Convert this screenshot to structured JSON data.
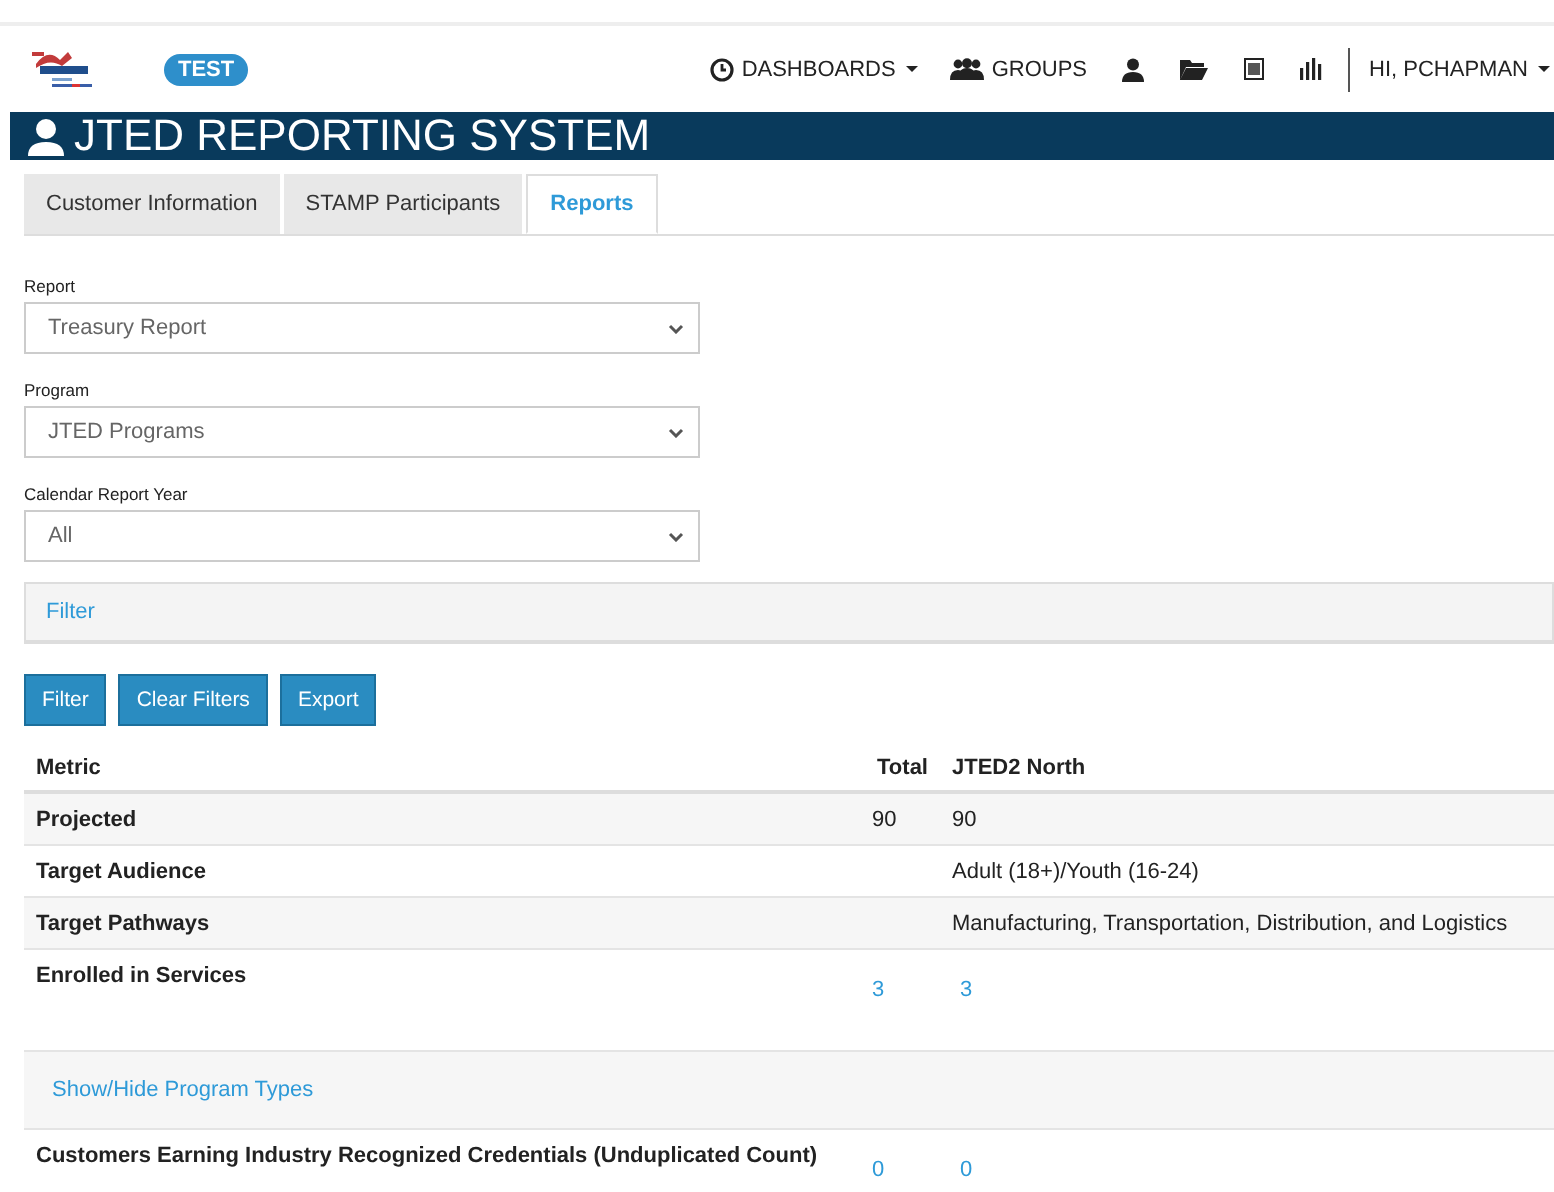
{
  "header": {
    "badge": "TEST",
    "nav": [
      {
        "label": "DASHBOARDS",
        "dropdown": true
      },
      {
        "label": "GROUPS",
        "dropdown": false
      }
    ],
    "user": {
      "label": "HI, PCHAPMAN",
      "dropdown": true
    }
  },
  "banner": {
    "title": "JTED REPORTING SYSTEM"
  },
  "tabs": [
    {
      "label": "Customer Information",
      "selected": false
    },
    {
      "label": "STAMP Participants",
      "selected": false
    },
    {
      "label": "Reports",
      "selected": true
    }
  ],
  "fields": [
    {
      "label": "Report",
      "value": "Treasury Report"
    },
    {
      "label": "Program",
      "value": "JTED Programs"
    },
    {
      "label": "Calendar Report Year",
      "value": "All"
    }
  ],
  "filter_panel": {
    "title": "Filter"
  },
  "buttons": [
    "Filter",
    "Clear Filters",
    "Export"
  ],
  "table": {
    "columns": [
      "Metric",
      "Total",
      "JTED2 North"
    ],
    "rows": [
      {
        "kind": "plain",
        "metric": "Projected",
        "total": "90",
        "north": "90"
      },
      {
        "kind": "plain",
        "metric": "Target Audience",
        "north": "Adult (18+)/Youth (16-24)"
      },
      {
        "kind": "plain",
        "metric": "Target Pathways",
        "north": "Manufacturing, Transportation, Distribution, and Logistics"
      },
      {
        "kind": "link",
        "metric": "Enrolled in Services",
        "total": "3",
        "north": "3"
      },
      {
        "kind": "toggle",
        "metric": "Show/Hide Program Types"
      },
      {
        "kind": "link",
        "metric": "Customers Earning Industry Recognized Credentials (Unduplicated Count)",
        "total": "0",
        "north": "0"
      }
    ]
  }
}
